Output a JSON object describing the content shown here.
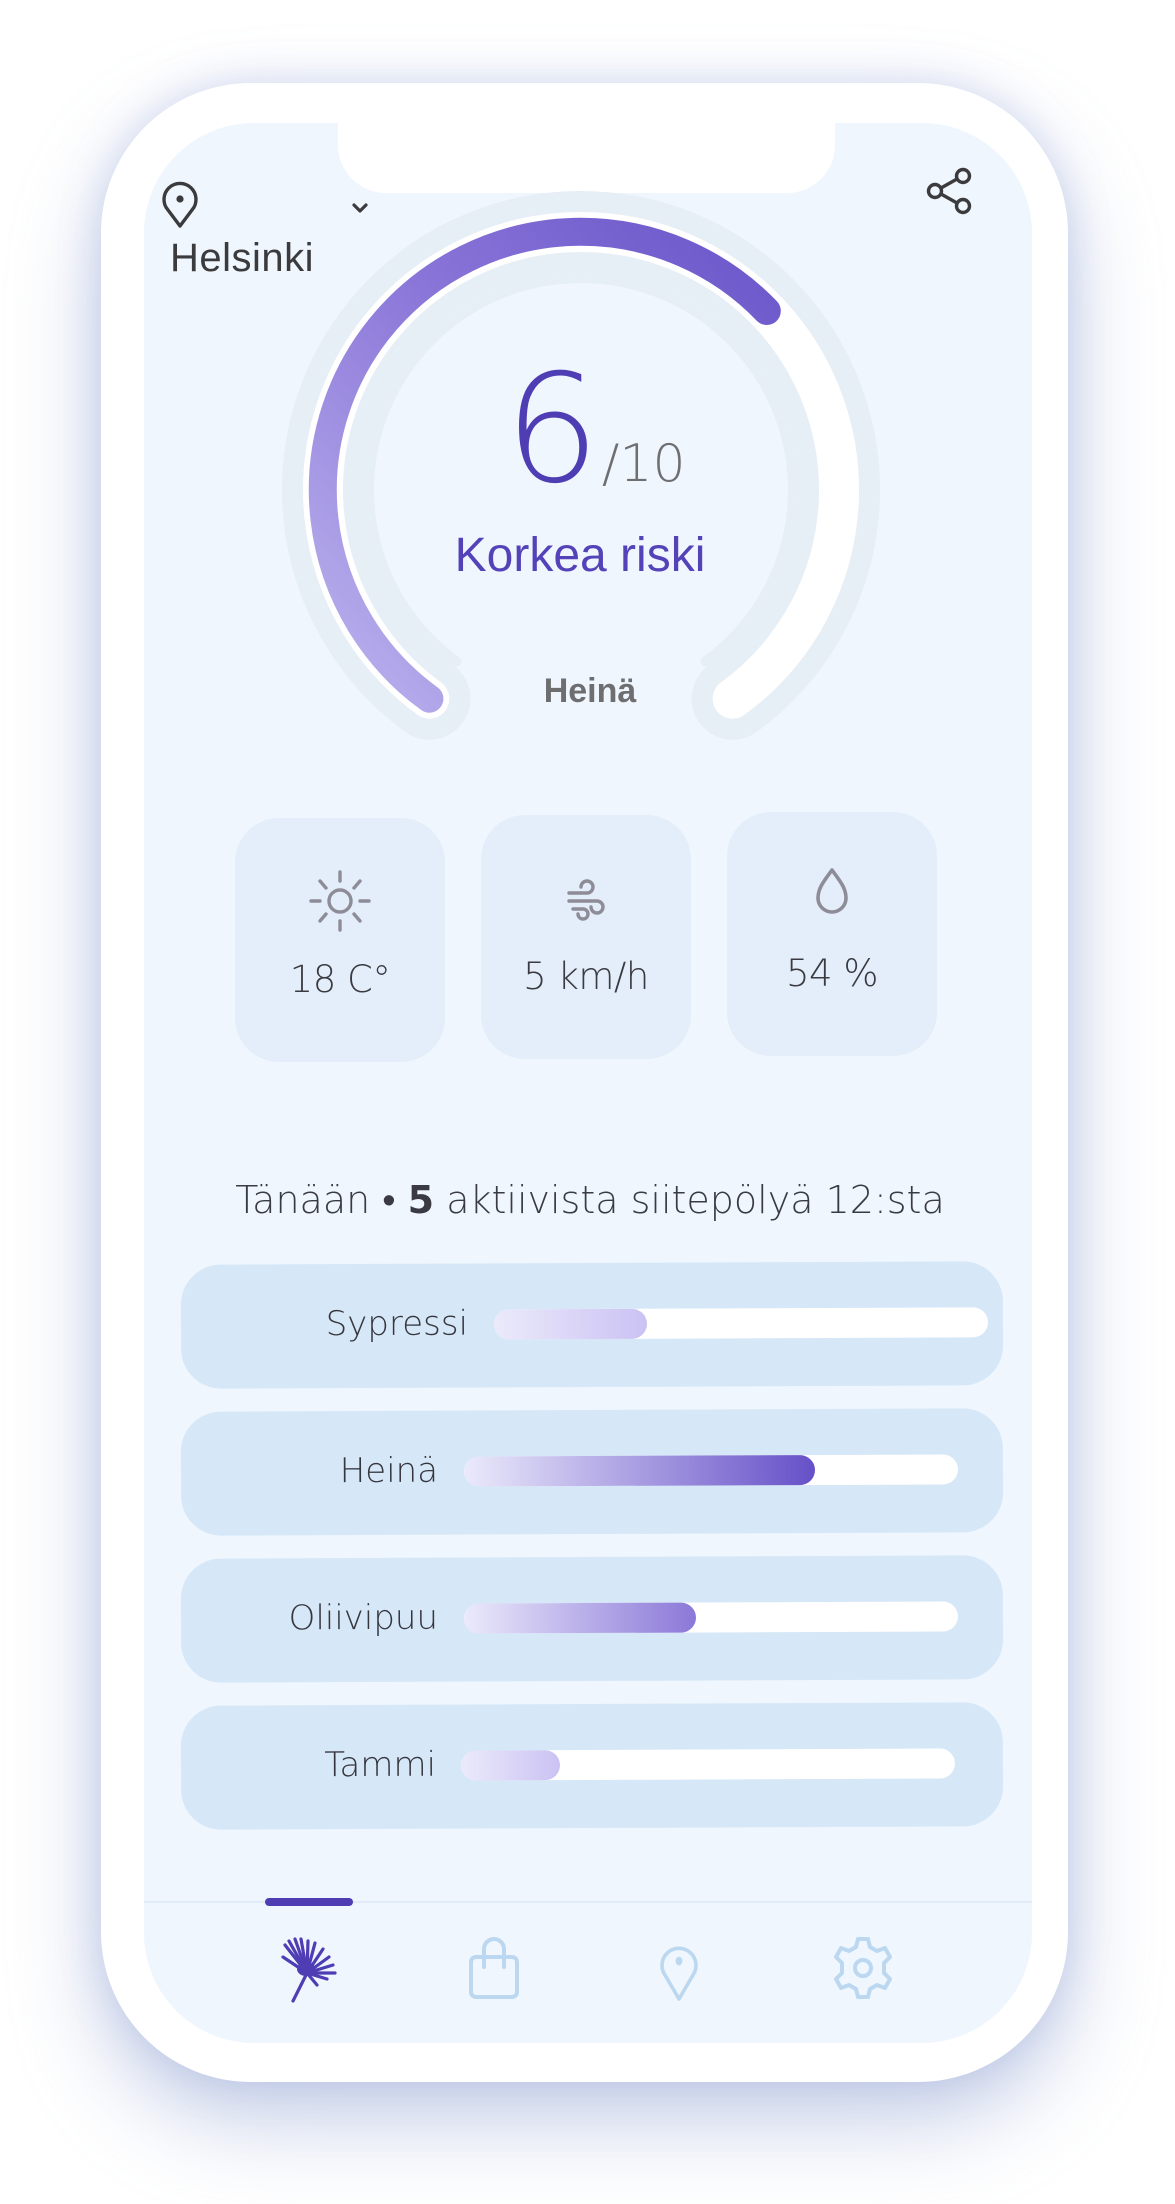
{
  "header": {
    "location_icon": "map-pin-icon",
    "dropdown_icon": "chevron-down-icon",
    "city": "Helsinki",
    "share_icon": "share-icon"
  },
  "risk": {
    "score": "6",
    "max_label": "/10",
    "score_value": 6,
    "score_max": 10,
    "level_label": "Korkea riski",
    "dominant_allergen": "Heinä"
  },
  "weather": [
    {
      "icon": "sun-icon",
      "value": "18 C°"
    },
    {
      "icon": "wind-icon",
      "value": "5 km/h"
    },
    {
      "icon": "droplet-icon",
      "value": "54 %"
    }
  ],
  "summary": {
    "prefix": "Tänään • ",
    "count": "5",
    "suffix": " aktiivista siitepölyä 12:sta"
  },
  "pollen": [
    {
      "name": "Sypressi",
      "level": 0.31
    },
    {
      "name": "Heinä",
      "level": 0.71
    },
    {
      "name": "Oliivipuu",
      "level": 0.47
    },
    {
      "name": "Tammi",
      "level": 0.2
    }
  ],
  "nav": {
    "active_index": 0,
    "items": [
      {
        "icon": "dandelion-icon",
        "name": "pollen"
      },
      {
        "icon": "shopping-bag-icon",
        "name": "shop"
      },
      {
        "icon": "map-pin-icon",
        "name": "map"
      },
      {
        "icon": "gear-icon",
        "name": "settings"
      }
    ]
  },
  "colors": {
    "accent": "#4f3db4",
    "accent_light": "#cfc7f4",
    "screen_bg": "#eff6fd",
    "card_bg": "#e3eefa",
    "row_bg": "#d6e7f7",
    "nav_inactive": "#bcd8f0",
    "icon_gray": "#8e8c97"
  }
}
